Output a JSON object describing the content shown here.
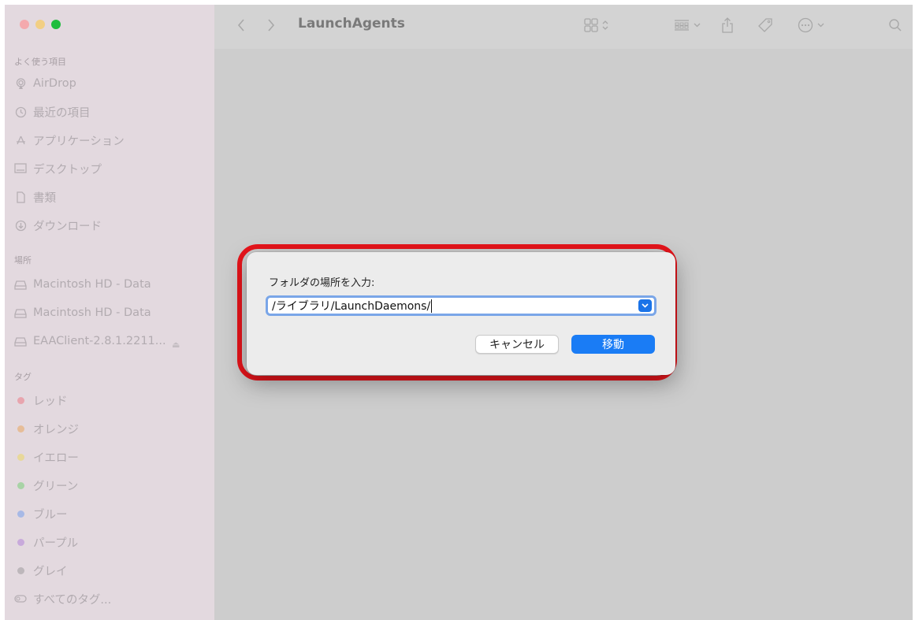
{
  "window": {
    "title": "LaunchAgents"
  },
  "sidebar": {
    "favorites_header": "よく使う項目",
    "favorites": [
      {
        "label": "AirDrop",
        "icon": "airdrop-icon"
      },
      {
        "label": "最近の項目",
        "icon": "clock-icon"
      },
      {
        "label": "アプリケーション",
        "icon": "applications-icon"
      },
      {
        "label": "デスクトップ",
        "icon": "desktop-icon"
      },
      {
        "label": "書類",
        "icon": "document-icon"
      },
      {
        "label": "ダウンロード",
        "icon": "download-icon"
      }
    ],
    "locations_header": "場所",
    "locations": [
      {
        "label": "Macintosh HD - Data",
        "icon": "disk-icon"
      },
      {
        "label": "Macintosh HD - Data",
        "icon": "disk-icon"
      },
      {
        "label": "EAAClient-2.8.1.2211...",
        "icon": "disk-icon",
        "eject": "⏏"
      }
    ],
    "tags_header": "タグ",
    "tags": [
      {
        "label": "レッド",
        "color": "#e8a5ae"
      },
      {
        "label": "オレンジ",
        "color": "#e6bd98"
      },
      {
        "label": "イエロー",
        "color": "#e8d89a"
      },
      {
        "label": "グリーン",
        "color": "#a8d3a6"
      },
      {
        "label": "ブルー",
        "color": "#a7b9e6"
      },
      {
        "label": "パープル",
        "color": "#c8aadb"
      },
      {
        "label": "グレイ",
        "color": "#bdb7bb"
      },
      {
        "label": "すべてのタグ...",
        "icon": "tag-outline-icon"
      }
    ]
  },
  "dialog": {
    "label": "フォルダの場所を入力:",
    "path_value": "/ライブラリ/LaunchDaemons/",
    "dropdown_glyph": "⌄",
    "cancel_label": "キャンセル",
    "go_label": "移動",
    "highlight_color": "#e8141b"
  }
}
